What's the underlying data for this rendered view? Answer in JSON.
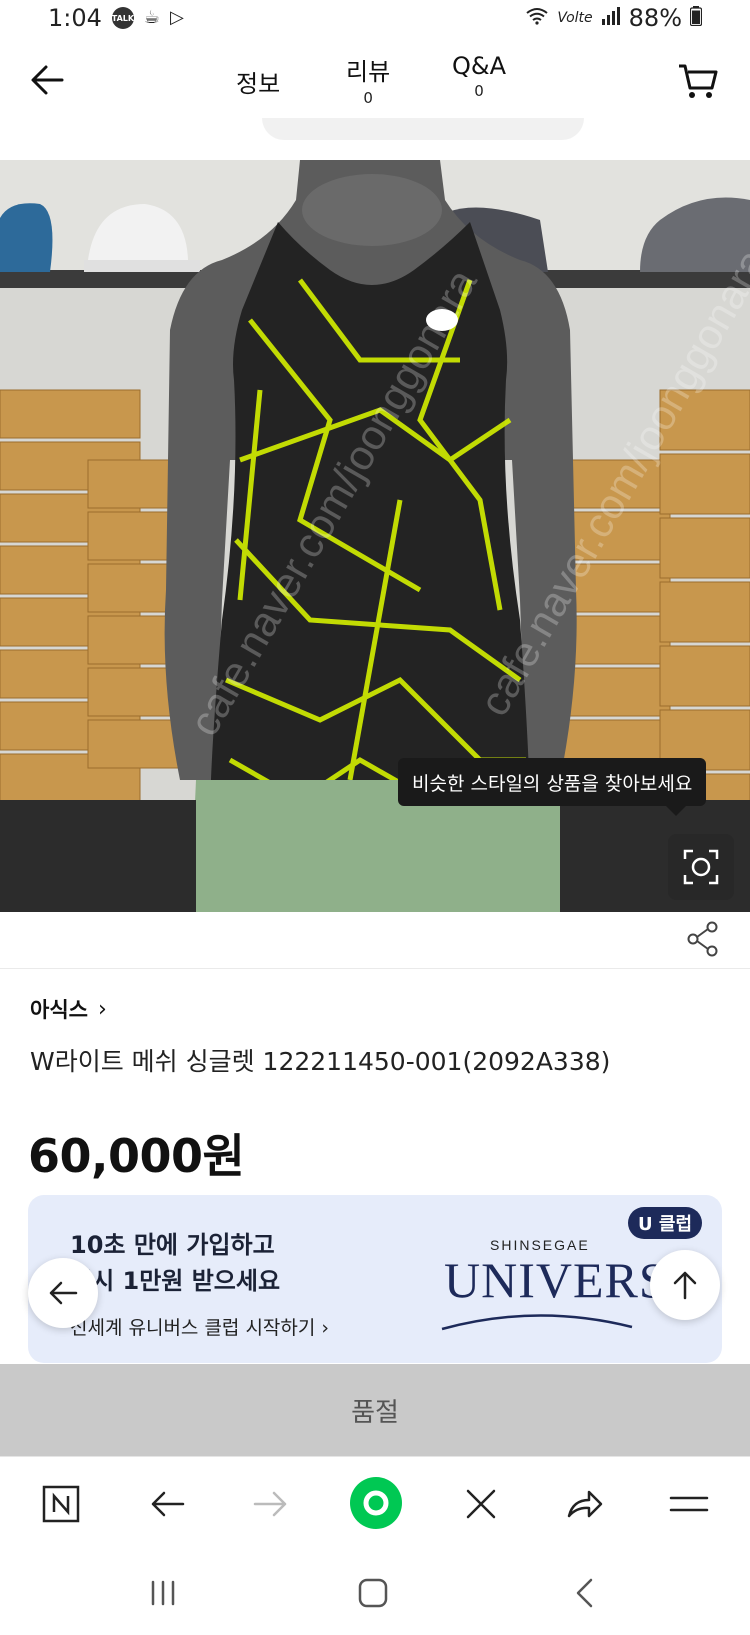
{
  "status_bar": {
    "time": "1:04",
    "talk_badge": "TALK",
    "network": "Volte",
    "battery": "88%"
  },
  "header": {
    "tabs": [
      {
        "label": "정보",
        "count": ""
      },
      {
        "label": "리뷰",
        "count": "0"
      },
      {
        "label": "Q&A",
        "count": "0"
      }
    ]
  },
  "image": {
    "tooltip": "비슷한 스타일의 상품을 찾아보세요",
    "watermark": "cafe.naver.com/joonggonara"
  },
  "product": {
    "brand": "아식스",
    "brand_chevron": "›",
    "title": "W라이트 메쉬 싱글렛 122211450-001(2092A338)",
    "price": "60,000원"
  },
  "banner": {
    "line1": "10초 만에 가입하고",
    "line2": "즉시 1만원 받으세요",
    "cta": "신세계 유니버스 클럽 시작하기 ›",
    "brand_top": "SHINSEGAE",
    "brand_main": "UNIVERSE",
    "badge": "U 클럽"
  },
  "soldout": "품절",
  "colors": {
    "accent_green": "#00c853",
    "banner_bg": "#e6ecfa",
    "brand_navy": "#1d2a5a",
    "soldout_bg": "#c9c9c9",
    "neon": "#d4f000"
  }
}
